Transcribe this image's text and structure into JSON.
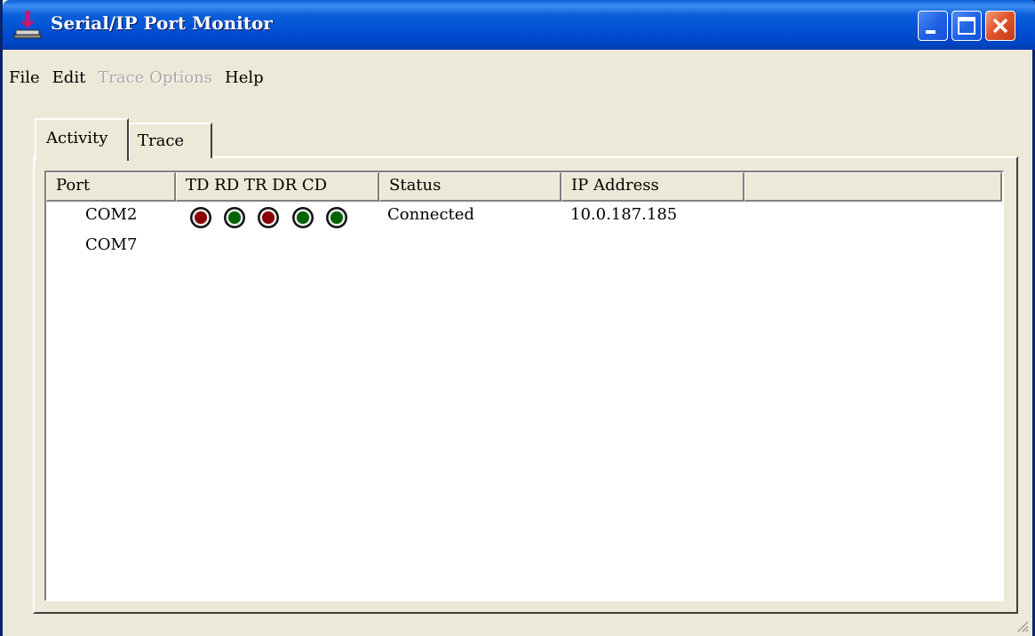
{
  "window": {
    "title": "Serial/IP Port Monitor",
    "icon": "serial-ip-app-icon",
    "controls": [
      "minimize-icon",
      "maximize-icon",
      "close-icon"
    ]
  },
  "menu": {
    "file": "File",
    "edit": "Edit",
    "trace_options": "Trace Options",
    "help": "Help"
  },
  "tabs": {
    "activity": "Activity",
    "trace": "Trace",
    "selected": "Activity"
  },
  "list": {
    "columns": {
      "port": "Port",
      "signals": "TD RD TR DR CD",
      "status": "Status",
      "ip_address": "IP Address"
    },
    "rows": [
      {
        "port": "COM2",
        "signals": {
          "TD": "red",
          "RD": "green",
          "TR": "red",
          "DR": "green",
          "CD": "green"
        },
        "status": "Connected",
        "ip_address": "10.0.187.185"
      },
      {
        "port": "COM7",
        "status": "",
        "ip_address": ""
      }
    ]
  },
  "colors": {
    "titlebar": "#0052d6",
    "led_red": "#8b0000",
    "led_green": "#006400",
    "face": "#ece9d8"
  }
}
